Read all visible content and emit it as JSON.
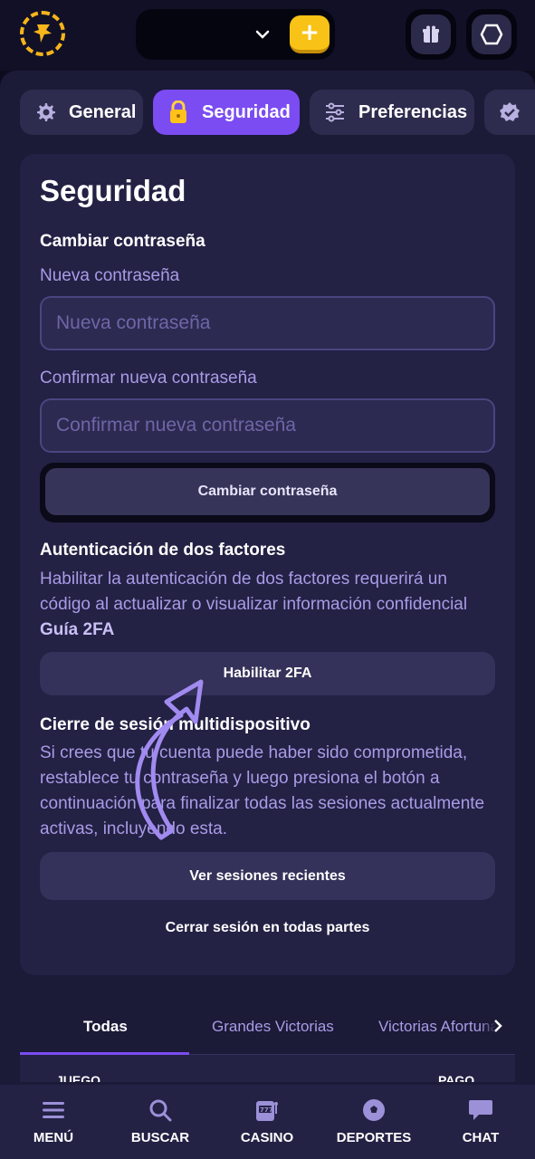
{
  "header": {
    "logo_icon": "lucky-seven-logo-icon",
    "wallet_dropdown_icon": "chevron-down-icon",
    "deposit_label": "+",
    "gift_icon": "gift-icon",
    "profile_icon": "hexagon-icon"
  },
  "tabs": [
    {
      "label": "General",
      "icon": "gear-icon",
      "active": false
    },
    {
      "label": "Seguridad",
      "icon": "lock-icon",
      "active": true
    },
    {
      "label": "Preferencias",
      "icon": "sliders-icon",
      "active": false
    },
    {
      "label": "",
      "icon": "verified-badge-icon",
      "active": false
    }
  ],
  "security": {
    "title": "Seguridad",
    "change_password": {
      "heading": "Cambiar contraseña",
      "new_label": "Nueva contraseña",
      "new_placeholder": "Nueva contraseña",
      "confirm_label": "Confirmar nueva contraseña",
      "confirm_placeholder": "Confirmar nueva contraseña",
      "button": "Cambiar contraseña"
    },
    "two_factor": {
      "heading": "Autenticación de dos factores",
      "description": "Habilitar la autenticación de dos factores requerirá un código al actualizar o visualizar información confidencial",
      "guide_link": "Guía 2FA",
      "button": "Habilitar 2FA"
    },
    "sessions": {
      "heading": "Cierre de sesión multidispositivo",
      "description": "Si crees que tu cuenta puede haber sido comprometida, restablece tu contraseña y luego presiona el botón a continuación para finalizar todas las sesiones actualmente activas, incluyendo esta.",
      "recent_button": "Ver sesiones recientes",
      "logout_all": "Cerrar sesión en todas partes"
    }
  },
  "bets": {
    "tabs": [
      "Todas",
      "Grandes Victorias",
      "Victorias Afortunadas"
    ],
    "active_tab": "Todas",
    "columns": [
      "JUEGO",
      "PAGO"
    ]
  },
  "bottom_nav": [
    {
      "label": "MENÚ",
      "icon": "menu-icon"
    },
    {
      "label": "BUSCAR",
      "icon": "search-icon"
    },
    {
      "label": "CASINO",
      "icon": "slot-machine-icon"
    },
    {
      "label": "DEPORTES",
      "icon": "soccer-ball-icon"
    },
    {
      "label": "CHAT",
      "icon": "chat-bubble-icon"
    }
  ],
  "colors": {
    "accent": "#7b4cf1",
    "deposit": "#f8c316",
    "label": "#a99be6"
  }
}
